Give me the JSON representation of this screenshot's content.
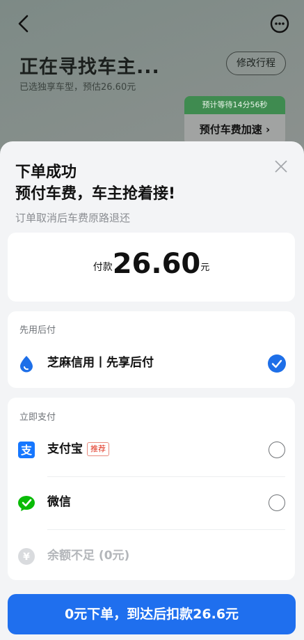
{
  "background": {
    "title": "正在寻找车主...",
    "subtitle": "已选独享车型，预估26.60元",
    "edit_button": "修改行程",
    "wait_tag": "预计等待14分56秒",
    "speed_button": "预付车费加速 ›"
  },
  "sheet": {
    "title_line1": "下单成功",
    "title_line2": "预付车费，车主抢着接!",
    "note": "订单取消后车费原路退还",
    "payment": {
      "label": "付款",
      "amount": "26.60",
      "unit": "元"
    },
    "pay_later": {
      "section_title": "先用后付",
      "option": {
        "label": "芝麻信用丨先享后付",
        "icon": "sesame-credit-icon",
        "selected": true
      }
    },
    "pay_now": {
      "section_title": "立即支付",
      "options": [
        {
          "label": "支付宝",
          "badge": "推荐",
          "icon": "alipay-icon",
          "selected": false
        },
        {
          "label": "微信",
          "icon": "wechat-icon",
          "selected": false
        },
        {
          "label": "余额不足 (0元)",
          "icon": "balance-yen-icon",
          "disabled": true
        }
      ]
    },
    "submit_button": "0元下单，到达后扣款26.6元"
  },
  "colors": {
    "primary": "#1f6fee",
    "badge": "#e0321f",
    "wechat": "#09bb07",
    "alipay": "#1677ff"
  }
}
